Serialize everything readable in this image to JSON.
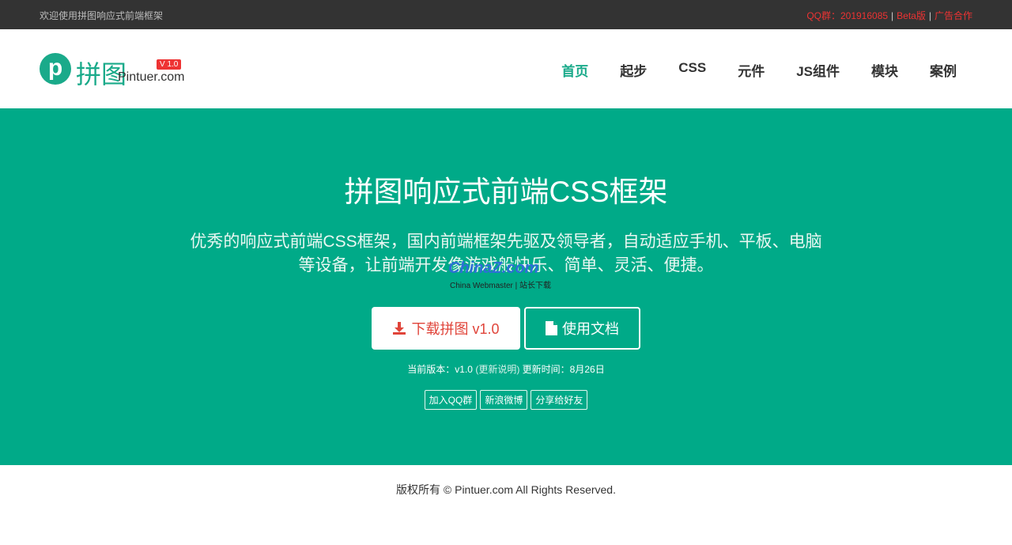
{
  "topbar": {
    "welcome": "欢迎使用拼图响应式前端框架",
    "qq": "QQ群：201916085",
    "beta": "Beta版",
    "ad": "广告合作",
    "separator": "|"
  },
  "logo": {
    "letter": "p",
    "cn": "拼图",
    "en": "Pintuer.com",
    "version": "V 1.0"
  },
  "nav": [
    "首页",
    "起步",
    "CSS",
    "元件",
    "JS组件",
    "模块",
    "案例"
  ],
  "hero": {
    "title": "拼图响应式前端CSS框架",
    "desc": "优秀的响应式前端CSS框架，国内前端框架先驱及领导者，自动适应手机、平板、电脑等设备，让前端开发像游戏般快乐、简单、灵活、便捷。",
    "download_label": "下载拼图 v1.0",
    "docs_label": "使用文档",
    "version_prefix": "当前版本：v1.0",
    "version_link": "(更新说明)",
    "update_time": "更新时间：8月26日",
    "tags": [
      "加入QQ群",
      "新浪微博",
      "分享给好友"
    ]
  },
  "watermark": {
    "main": "ChinaZ.com",
    "sub": "China Webmaster | 站长下载"
  },
  "footer": {
    "copyright": "版权所有 © Pintuer.com All Rights Reserved."
  },
  "colors": {
    "brand": "#1aaa8a",
    "hero_bg": "#00aa88",
    "accent_red": "#e33333",
    "topbar_bg": "#333333"
  }
}
